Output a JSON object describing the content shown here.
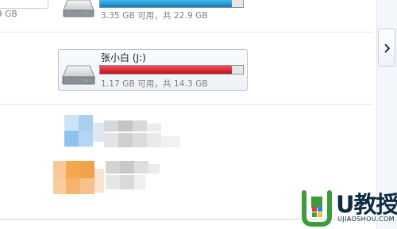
{
  "drives": [
    {
      "label": "",
      "capacity_text": "9 GB",
      "fill_fraction": 0.0,
      "bar_color": "#1a90d6"
    },
    {
      "label": "",
      "capacity_text": "3.35 GB 可用，共 22.9 GB",
      "fill_fraction": 0.85,
      "bar_color": "#1a90d6"
    },
    {
      "label": "张小白 (J:)",
      "capacity_text": "1.17 GB 可用，共 14.3 GB",
      "fill_fraction": 0.92,
      "bar_color": "#d9101b"
    }
  ],
  "watermark": {
    "text_big": "U教授",
    "text_small": "UJIAOSHOU.COM"
  },
  "colors": {
    "accent_blue": "#1a90d6",
    "warning_red": "#d9101b",
    "watermark_green": "#3c9c3a"
  }
}
